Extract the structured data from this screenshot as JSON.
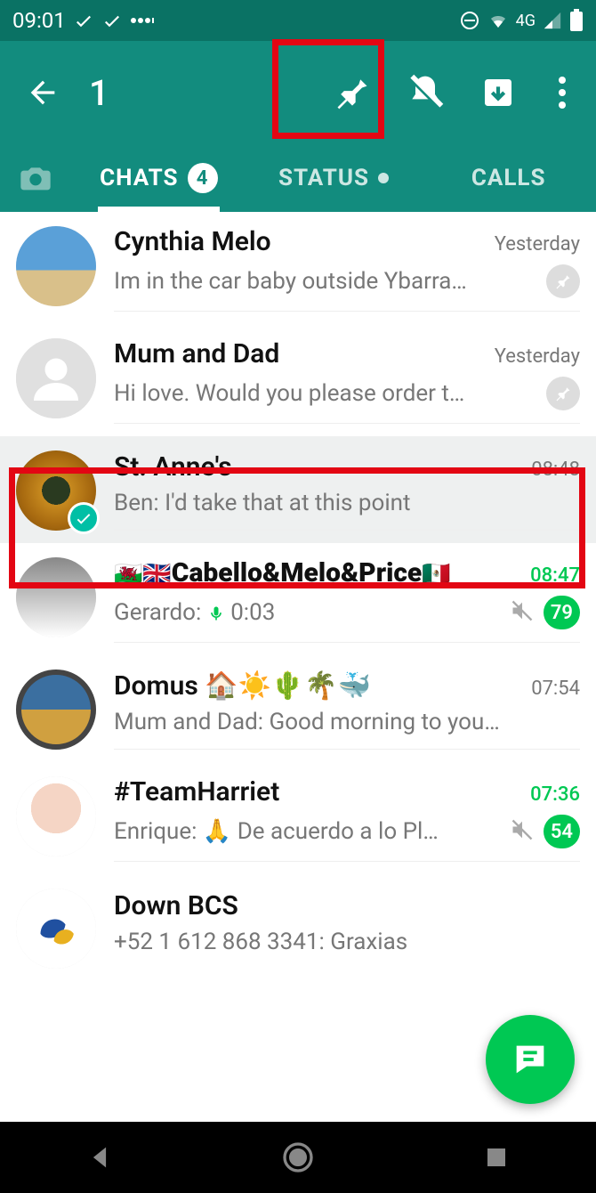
{
  "statusbar": {
    "time": "09:01",
    "network": "4G"
  },
  "actionbar": {
    "selected_count": "1"
  },
  "tabs": {
    "chats_label": "CHATS",
    "chats_badge": "4",
    "status_label": "STATUS",
    "calls_label": "CALLS"
  },
  "chats": [
    {
      "name": "Cynthia Melo",
      "time": "Yesterday",
      "preview": "Im in the car baby outside Ybarra…",
      "pinned": true,
      "selected": false,
      "avatar": "beach"
    },
    {
      "name": "Mum and Dad",
      "time": "Yesterday",
      "preview": "Hi love. Would you please order t…",
      "pinned": true,
      "selected": false,
      "avatar": "default"
    },
    {
      "name": "St. Anne's",
      "time": "08:48",
      "preview": "Ben: I'd take that at this point",
      "pinned": false,
      "selected": true,
      "avatar": "forest"
    },
    {
      "name_prefix": "🏴󠁧󠁢󠁷󠁬󠁳󠁿🇬🇧",
      "name": "Cabello&Melo&Price",
      "name_suffix": "🇲🇽",
      "time": "08:47",
      "time_unread": true,
      "preview": "Gerardo: 🎤 0:03",
      "muted": true,
      "count": "79",
      "avatar": "dinner"
    },
    {
      "name": "Domus 🏠☀️🌵🌴🐳",
      "time": "07:54",
      "preview": "Mum and Dad: Good morning to you…",
      "avatar": "arch"
    },
    {
      "name": "#TeamHarriet",
      "time": "07:36",
      "time_unread": true,
      "preview": "Enrique: 🙏 De acuerdo a lo Pl…",
      "muted": true,
      "count": "54",
      "avatar": "baby"
    },
    {
      "name": "Down BCS",
      "time": "",
      "preview": "+52 1 612 868 3341: Graxias",
      "avatar": "hands"
    }
  ]
}
